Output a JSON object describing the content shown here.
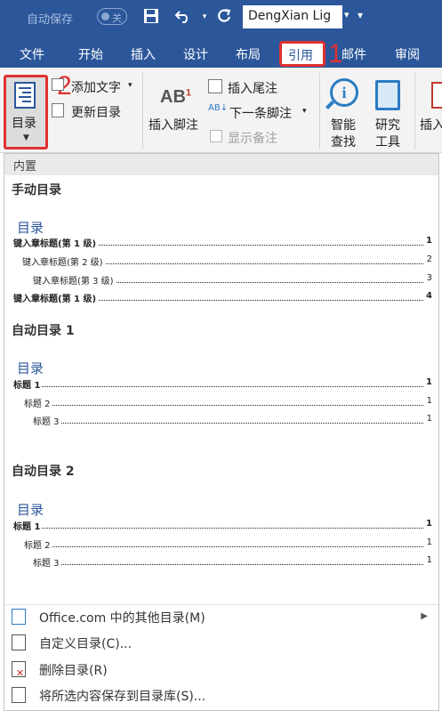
{
  "titlebar": {
    "autosave_label": "自动保存",
    "autosave_state": "关",
    "font_name": "DengXian Lig",
    "icons": [
      "save-icon",
      "undo-icon",
      "redo-icon"
    ]
  },
  "tabs": [
    "文件",
    "开始",
    "插入",
    "设计",
    "布局",
    "引用",
    "邮件",
    "审阅"
  ],
  "active_tab": "引用",
  "annotations": {
    "step1": "1",
    "step2": "2",
    "color": "#e03131"
  },
  "ribbon": {
    "toc_button": "目录",
    "add_text": "添加文字",
    "update_toc": "更新目录",
    "insert_footnote": "插入脚注",
    "insert_endnote": "插入尾注",
    "next_footnote": "下一条脚注",
    "show_notes": "显示备注",
    "smart_lookup_1": "智能",
    "smart_lookup_2": "查找",
    "research_1": "研究",
    "research_2": "工具",
    "insert_more": "插入"
  },
  "panel": {
    "header": "内置",
    "manual": {
      "title": "手动目录",
      "heading": "目录",
      "lines": [
        {
          "text": "键入章标题(第 1 级)",
          "page": "1"
        },
        {
          "text": "键入章标题(第 2 级)",
          "page": "2"
        },
        {
          "text": "键入章标题(第 3 级)",
          "page": "3"
        },
        {
          "text": "键入章标题(第 1 级)",
          "page": "4"
        }
      ]
    },
    "auto1": {
      "title": "自动目录 1",
      "heading": "目录",
      "lines": [
        {
          "text": "标题 1",
          "page": "1"
        },
        {
          "text": "标题 2",
          "page": "1"
        },
        {
          "text": "标题 3",
          "page": "1"
        }
      ]
    },
    "auto2": {
      "title": "自动目录 2",
      "heading": "目录",
      "lines": [
        {
          "text": "标题 1",
          "page": "1"
        },
        {
          "text": "标题 2",
          "page": "1"
        },
        {
          "text": "标题 3",
          "page": "1"
        }
      ]
    },
    "menu": {
      "office": "Office.com 中的其他目录(M)",
      "custom": "自定义目录(C)...",
      "remove": "删除目录(R)",
      "save": "将所选内容保存到目录库(S)..."
    }
  },
  "colors": {
    "brand": "#2b579a",
    "accent": "#2b7bc4",
    "highlight": "#e03131"
  }
}
